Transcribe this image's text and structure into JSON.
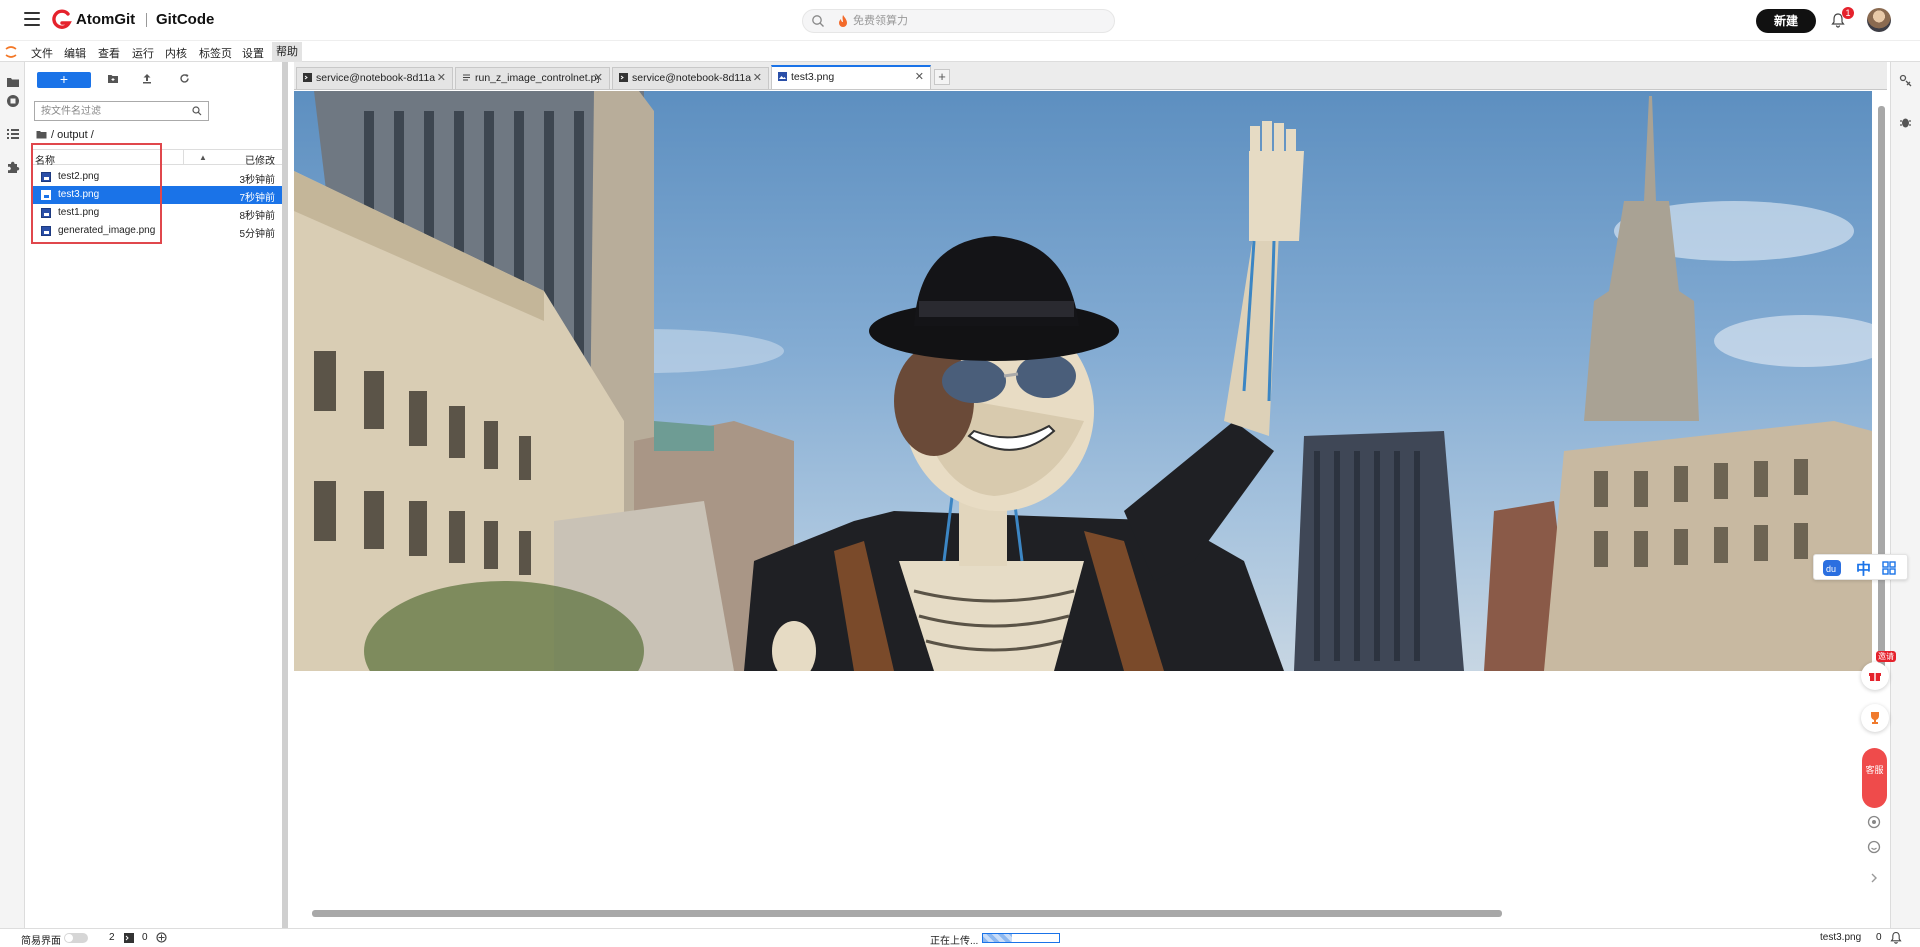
{
  "header": {
    "brand": "AtomGit",
    "brand2": "GitCode",
    "search_placeholder": "免费领算力",
    "new_button": "新建",
    "notification_count": "1"
  },
  "menu": {
    "items": [
      "文件",
      "编辑",
      "查看",
      "运行",
      "内核",
      "标签页",
      "设置",
      "帮助"
    ]
  },
  "filebrowser": {
    "filter_placeholder": "按文件名过滤",
    "breadcrumb": "/ output /",
    "col_name": "名称",
    "col_modified": "已修改",
    "files": [
      {
        "name": "test2.png",
        "modified": "3秒钟前",
        "selected": false
      },
      {
        "name": "test3.png",
        "modified": "7秒钟前",
        "selected": true
      },
      {
        "name": "test1.png",
        "modified": "8秒钟前",
        "selected": false
      },
      {
        "name": "generated_image.png",
        "modified": "5分钟前",
        "selected": false
      }
    ]
  },
  "tabs": [
    {
      "label": "service@notebook-8d11a",
      "icon": "terminal-icon",
      "active": false
    },
    {
      "label": "run_z_image_controlnet.py",
      "icon": "file-text-icon",
      "active": false
    },
    {
      "label": "service@notebook-8d11a",
      "icon": "terminal-icon",
      "active": false
    },
    {
      "label": "test3.png",
      "icon": "image-icon",
      "active": true
    }
  ],
  "floating": {
    "lang": "中",
    "invite": "邀请",
    "service": "客服"
  },
  "status": {
    "simple_mode": "简易界面",
    "count_a": "2",
    "count_b": "0",
    "uploading": "正在上传...",
    "upload_progress": 0.38,
    "current_file": "test3.png",
    "right_count": "0"
  },
  "colors": {
    "accent": "#1a73e8",
    "brand_red": "#e5222c",
    "highlight_box": "#e0474c"
  }
}
